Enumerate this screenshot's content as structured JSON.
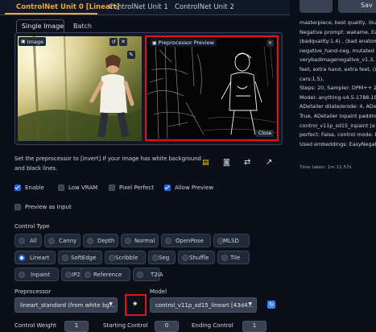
{
  "tabs": {
    "unit0": "ControlNet Unit 0 [Lineart]",
    "unit1": "ControlNet Unit 1",
    "unit2": "ControlNet Unit 2"
  },
  "subtabs": {
    "single": "Single Image",
    "batch": "Batch"
  },
  "image_panel": {
    "label": "Image",
    "icons": [
      "image-icon",
      "undo-icon",
      "close-icon",
      "edit-icon"
    ]
  },
  "preview_panel": {
    "label": "Preprocessor Preview",
    "close_label": "Close"
  },
  "hint": {
    "line1": "Set the preprocessor to [invert] If your image has white background",
    "line2": "and black lines."
  },
  "toolbar_icons": [
    "note-icon",
    "camera-icon",
    "swap-icon",
    "upload-arrow-icon"
  ],
  "options": {
    "enable": {
      "label": "Enable",
      "checked": true
    },
    "low_vram": {
      "label": "Low VRAM",
      "checked": false
    },
    "pixel_perfect": {
      "label": "Pixel Perfect",
      "checked": false
    },
    "allow_preview": {
      "label": "Allow Preview",
      "checked": true
    },
    "preview_as_input": {
      "label": "Preview as Input",
      "checked": false
    }
  },
  "control_type": {
    "label": "Control Type",
    "selected": "Lineart",
    "rows": [
      [
        "All",
        "Canny",
        "Depth",
        "Normal",
        "OpenPose",
        "MLSD"
      ],
      [
        "Lineart",
        "SoftEdge",
        "Scribble",
        "Seg",
        "Shuffle",
        "Tile"
      ],
      [
        "Inpaint",
        "IP2P",
        "Reference",
        "T2IA"
      ]
    ]
  },
  "preprocessor": {
    "label": "Preprocessor",
    "value": "lineart_standard (from white bg..."
  },
  "model": {
    "label": "Model",
    "value": "control_v11p_sd15_lineart [43d4..."
  },
  "run_icon": "star-burst-icon",
  "refresh_icon": "refresh-icon",
  "sliders": {
    "weight": {
      "label": "Control Weight",
      "value": "1"
    },
    "start": {
      "label": "Starting Control",
      "value": "0"
    },
    "end": {
      "label": "Ending Control",
      "value": "1"
    }
  },
  "right_panel": {
    "save_label": "Sav",
    "lines": [
      "masterpiece, best quality, illus",
      "Negative prompt: wakame, Eas",
      "(badquality:1.4) , (bad anatom",
      "negative_hand-neg, mutated h",
      "verybadimagenegative_v1.3, a",
      "feet, extra hand, extra feet, (ns",
      "cars:1.5),",
      "Steps: 20, Sampler: DPM++ 2S",
      "Model: anything-v4.5-1788-192",
      "ADetailer dilate/erode: 4, ADeta",
      "True, ADetailer inpaint padding",
      "control_v11p_sd15_inpaint [e",
      "perfect: False, control mode: B",
      "Used embeddings: EasyNegati"
    ],
    "time_taken": "Time taken: 1m 11.57s"
  },
  "colors": {
    "accent": "#f3a637",
    "highlight": "#e01414",
    "checkbox": "#2563eb"
  }
}
